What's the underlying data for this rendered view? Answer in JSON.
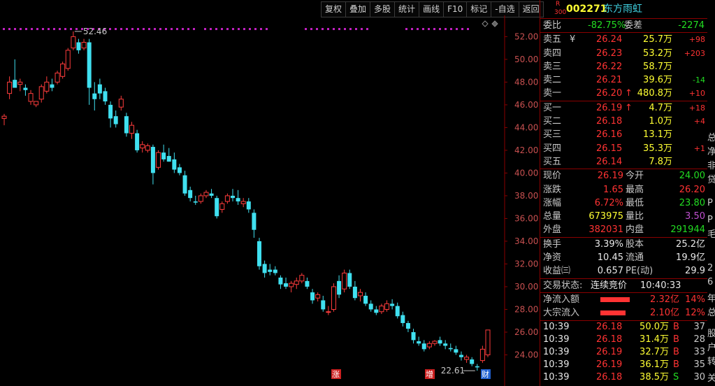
{
  "toolbar": [
    "复权",
    "叠加",
    "多股",
    "统计",
    "画线",
    "F10",
    "标记",
    "-自选",
    "返回"
  ],
  "stock": {
    "r_label": "R",
    "r_sub": "300",
    "code": "002271",
    "name": "东方雨虹"
  },
  "weibi": {
    "label1": "委比",
    "val1": "-82.75%",
    "label2": "委差",
    "val2": "-2274"
  },
  "sell": [
    {
      "label": "卖五",
      "suffix": "¥",
      "price": "26.24",
      "vol": "25.7万",
      "chg": "+98"
    },
    {
      "label": "卖四",
      "suffix": "",
      "price": "26.23",
      "vol": "53.2万",
      "chg": "+203"
    },
    {
      "label": "卖三",
      "suffix": "",
      "price": "26.22",
      "vol": "58.7万",
      "chg": ""
    },
    {
      "label": "卖二",
      "suffix": "",
      "price": "26.21",
      "vol": "39.6万",
      "chg": "-14"
    },
    {
      "label": "卖一",
      "suffix": "",
      "price": "26.20",
      "arrow": "↑",
      "vol": "480.8万",
      "chg": "+10"
    }
  ],
  "buy": [
    {
      "label": "买一",
      "price": "26.19",
      "arrow": "↑",
      "vol": "4.7万",
      "chg": "+18"
    },
    {
      "label": "买二",
      "price": "26.18",
      "vol": "1.0万",
      "chg": "+4"
    },
    {
      "label": "买三",
      "price": "26.16",
      "vol": "13.1万",
      "chg": ""
    },
    {
      "label": "买四",
      "price": "26.15",
      "vol": "35.3万",
      "chg": "+1"
    },
    {
      "label": "买五",
      "price": "26.14",
      "vol": "7.8万",
      "chg": ""
    }
  ],
  "quote": [
    {
      "l1": "现价",
      "v1": "26.19",
      "c1": "red",
      "l2": "今开",
      "v2": "24.00",
      "c2": "green"
    },
    {
      "l1": "涨跌",
      "v1": "1.65",
      "c1": "red",
      "l2": "最高",
      "v2": "26.20",
      "c2": "red"
    },
    {
      "l1": "涨幅",
      "v1": "6.72%",
      "c1": "red",
      "l2": "最低",
      "v2": "23.80",
      "c2": "green"
    },
    {
      "l1": "总量",
      "v1": "673975",
      "c1": "yellow",
      "l2": "量比",
      "v2": "3.50",
      "c2": "purple"
    },
    {
      "l1": "外盘",
      "v1": "382031",
      "c1": "red",
      "l2": "内盘",
      "v2": "291944",
      "c2": "green"
    }
  ],
  "fund": [
    {
      "l1": "换手",
      "v1": "3.39%",
      "l2": "股本",
      "v2": "25.2亿"
    },
    {
      "l1": "净资",
      "v1": "10.45",
      "l2": "流通",
      "v2": "19.9亿"
    },
    {
      "l1": "收益㈢",
      "v1": "0.657",
      "l2": "PE(动)",
      "v2": "29.9"
    }
  ],
  "status": {
    "label": "交易状态:",
    "value": "连续竞价",
    "time": "10:40:33"
  },
  "flows": [
    {
      "label": "净流入额",
      "value": "2.32亿",
      "pct": "14%",
      "level": 0.14
    },
    {
      "label": "大宗流入",
      "value": "2.10亿",
      "pct": "12%",
      "level": 0.12
    }
  ],
  "ticks": [
    {
      "time": "10:39",
      "price": "26.18",
      "vol": "50.0万",
      "side": "B",
      "n": "37"
    },
    {
      "time": "10:39",
      "price": "26.18",
      "vol": "31.4万",
      "side": "B",
      "n": "28"
    },
    {
      "time": "10:39",
      "price": "26.19",
      "vol": "32.7万",
      "side": "B",
      "n": "33"
    },
    {
      "time": "10:39",
      "price": "26.19",
      "vol": "36.1万",
      "side": "B",
      "n": "35"
    },
    {
      "time": "10:39",
      "price": "26.18",
      "vol": "38.5万",
      "side": "S",
      "n": "30"
    }
  ],
  "far_right_chars": [
    "总",
    "净",
    "非",
    "贷",
    "P",
    "P",
    "毛",
    "2",
    "6",
    "年",
    "总",
    "股",
    "户",
    "转",
    "关"
  ],
  "chart_data": {
    "type": "candlestick",
    "y_ticks": [
      "52.00",
      "50.00",
      "48.00",
      "46.00",
      "44.00",
      "42.00",
      "40.00",
      "38.00",
      "36.00",
      "34.00",
      "32.00",
      "30.00",
      "28.00",
      "26.00",
      "24.00"
    ],
    "ylim": [
      22.0,
      53.5
    ],
    "high_label": "52.46",
    "low_label": "22.61",
    "markers": [
      "涨",
      "增",
      "财"
    ],
    "candles": [
      [
        44.8,
        45.2,
        44.2,
        45.0
      ],
      [
        47.0,
        48.5,
        46.5,
        48.0
      ],
      [
        48.2,
        50.0,
        47.8,
        47.5
      ],
      [
        47.8,
        48.3,
        47.2,
        48.0
      ],
      [
        47.5,
        47.8,
        46.8,
        47.3
      ],
      [
        46.3,
        47.3,
        46.0,
        47.0
      ],
      [
        46.0,
        46.3,
        45.8,
        46.3
      ],
      [
        46.5,
        47.8,
        46.2,
        47.6
      ],
      [
        47.2,
        48.5,
        47.0,
        48.0
      ],
      [
        47.8,
        48.3,
        47.2,
        47.5
      ],
      [
        48.0,
        49.0,
        47.8,
        48.8
      ],
      [
        48.5,
        49.8,
        48.3,
        49.6
      ],
      [
        49.2,
        51.0,
        49.0,
        50.8
      ],
      [
        51.0,
        52.46,
        50.8,
        52.0
      ],
      [
        51.5,
        51.8,
        50.5,
        50.8
      ],
      [
        51.0,
        51.8,
        50.8,
        51.5
      ],
      [
        51.5,
        51.8,
        46.0,
        47.5
      ],
      [
        47.0,
        48.0,
        45.5,
        46.5
      ],
      [
        47.8,
        48.3,
        46.5,
        47.0
      ],
      [
        47.2,
        47.5,
        46.0,
        46.3
      ],
      [
        46.0,
        46.3,
        44.0,
        44.8
      ],
      [
        45.0,
        45.5,
        44.0,
        44.3
      ],
      [
        45.8,
        46.8,
        45.5,
        46.5
      ],
      [
        45.0,
        45.3,
        43.2,
        43.5
      ],
      [
        43.5,
        44.5,
        43.0,
        44.2
      ],
      [
        43.5,
        43.8,
        41.8,
        42.0
      ],
      [
        42.2,
        42.8,
        41.8,
        42.5
      ],
      [
        42.0,
        42.6,
        41.8,
        42.4
      ],
      [
        42.3,
        42.5,
        39.0,
        40.0
      ],
      [
        40.5,
        42.0,
        40.3,
        41.8
      ],
      [
        41.8,
        42.5,
        41.0,
        41.2
      ],
      [
        41.5,
        42.2,
        41.0,
        41.0
      ],
      [
        41.2,
        41.8,
        40.0,
        40.3
      ],
      [
        40.5,
        40.8,
        39.8,
        40.0
      ],
      [
        39.8,
        40.2,
        38.0,
        38.2
      ],
      [
        38.5,
        38.8,
        37.5,
        37.8
      ],
      [
        37.5,
        38.0,
        37.2,
        37.4
      ],
      [
        37.5,
        38.2,
        37.3,
        38.0
      ],
      [
        38.0,
        38.5,
        37.8,
        38.3
      ],
      [
        38.2,
        38.6,
        37.8,
        38.0
      ],
      [
        37.8,
        38.0,
        36.0,
        36.2
      ],
      [
        36.8,
        37.5,
        36.5,
        37.3
      ],
      [
        37.5,
        38.2,
        37.3,
        38.0
      ],
      [
        38.0,
        38.6,
        37.5,
        37.8
      ],
      [
        37.8,
        38.5,
        37.2,
        37.5
      ],
      [
        37.3,
        37.8,
        37.0,
        37.5
      ],
      [
        37.5,
        37.8,
        36.5,
        36.8
      ],
      [
        36.5,
        36.8,
        34.3,
        35.0
      ],
      [
        34.0,
        34.3,
        31.5,
        31.8
      ],
      [
        32.0,
        32.3,
        30.8,
        31.2
      ],
      [
        31.5,
        32.0,
        31.0,
        31.3
      ],
      [
        31.5,
        31.8,
        31.0,
        31.2
      ],
      [
        30.8,
        31.0,
        29.8,
        30.2
      ],
      [
        30.3,
        30.8,
        29.8,
        30.0
      ],
      [
        30.0,
        30.5,
        29.5,
        30.3
      ],
      [
        30.2,
        30.8,
        29.8,
        30.5
      ],
      [
        30.5,
        31.2,
        30.3,
        31.0
      ],
      [
        30.5,
        30.8,
        29.8,
        30.0
      ],
      [
        29.5,
        29.8,
        28.5,
        28.8
      ],
      [
        29.0,
        29.5,
        28.7,
        29.3
      ],
      [
        28.8,
        29.2,
        27.8,
        28.0
      ],
      [
        27.8,
        28.3,
        27.5,
        27.8
      ],
      [
        28.0,
        30.3,
        27.8,
        30.0
      ],
      [
        30.5,
        31.0,
        29.0,
        29.3
      ],
      [
        29.8,
        31.5,
        29.5,
        31.2
      ],
      [
        31.2,
        31.5,
        29.8,
        30.0
      ],
      [
        30.0,
        30.5,
        28.8,
        29.0
      ],
      [
        29.2,
        29.8,
        28.7,
        29.5
      ],
      [
        29.2,
        29.5,
        28.3,
        28.5
      ],
      [
        28.5,
        28.8,
        27.8,
        28.0
      ],
      [
        28.0,
        28.3,
        27.5,
        27.7
      ],
      [
        27.8,
        28.5,
        27.6,
        28.3
      ],
      [
        28.0,
        28.8,
        27.8,
        28.5
      ],
      [
        28.5,
        28.9,
        28.0,
        28.3
      ],
      [
        28.3,
        28.6,
        27.2,
        27.4
      ],
      [
        27.5,
        27.8,
        26.5,
        26.8
      ],
      [
        26.8,
        27.0,
        26.0,
        26.3
      ],
      [
        26.0,
        26.3,
        25.0,
        25.3
      ],
      [
        25.2,
        25.6,
        24.8,
        25.0
      ],
      [
        25.0,
        25.3,
        24.3,
        24.5
      ],
      [
        24.7,
        25.2,
        24.5,
        25.0
      ],
      [
        25.0,
        25.3,
        24.8,
        25.2
      ],
      [
        25.3,
        25.6,
        24.8,
        25.0
      ],
      [
        25.0,
        25.3,
        24.5,
        24.8
      ],
      [
        24.6,
        25.0,
        24.3,
        24.5
      ],
      [
        24.5,
        24.8,
        24.0,
        24.2
      ],
      [
        24.0,
        24.3,
        23.5,
        23.8
      ],
      [
        23.6,
        24.0,
        23.3,
        23.8
      ],
      [
        23.6,
        23.8,
        23.0,
        23.2
      ],
      [
        23.0,
        23.2,
        22.61,
        22.9
      ],
      [
        23.5,
        24.8,
        23.3,
        24.5
      ],
      [
        24.0,
        26.2,
        23.8,
        26.19
      ]
    ]
  }
}
